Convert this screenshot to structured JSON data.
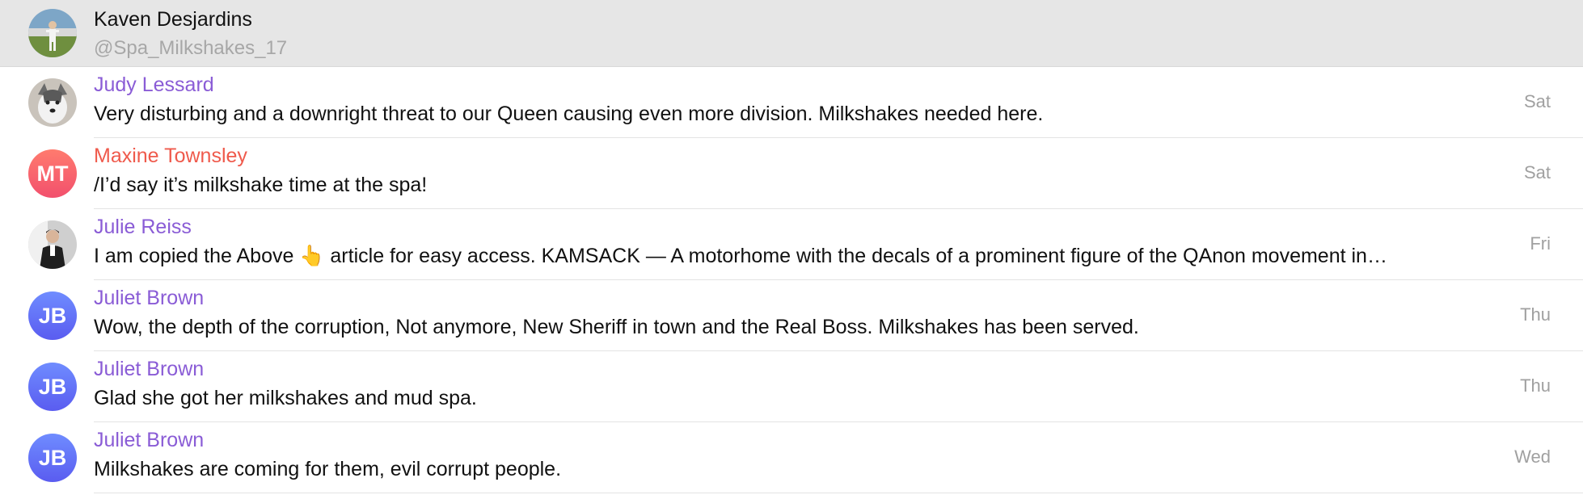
{
  "header": {
    "name": "Kaven Desjardins",
    "handle": "@Spa_Milkshakes_17"
  },
  "rows": [
    {
      "name": "Judy Lessard",
      "message": "Very disturbing and a downright threat to our Queen causing even more division. Milkshakes needed here.",
      "date": "Sat",
      "avatar": "dog-photo"
    },
    {
      "name": "Maxine Townsley",
      "message": "/I’d say it’s milkshake time at the spa!",
      "date": "Sat",
      "avatar_initials": "MT"
    },
    {
      "name": "Julie Reiss",
      "message": "I am copied the Above 👆 article for easy access.  KAMSACK — A motorhome with the decals of a prominent figure of the QAnon movement in…",
      "date": "Fri",
      "avatar": "person-photo"
    },
    {
      "name": "Juliet Brown",
      "message": "Wow, the depth of the corruption, Not anymore, New Sheriff in town and the Real Boss. Milkshakes has been served.",
      "date": "Thu",
      "avatar_initials": "JB"
    },
    {
      "name": "Juliet Brown",
      "message": "Glad she got her milkshakes and mud spa.",
      "date": "Thu",
      "avatar_initials": "JB"
    },
    {
      "name": "Juliet Brown",
      "message": "Milkshakes are coming for them, evil corrupt people.",
      "date": "Wed",
      "avatar_initials": "JB"
    }
  ],
  "colors": {
    "header_bg": "#e6e6e6",
    "name_purple": "#8a5cd6",
    "name_red": "#ef5a4c",
    "avatar_blue": "#5a5cf0",
    "avatar_red": "#f2506d"
  }
}
